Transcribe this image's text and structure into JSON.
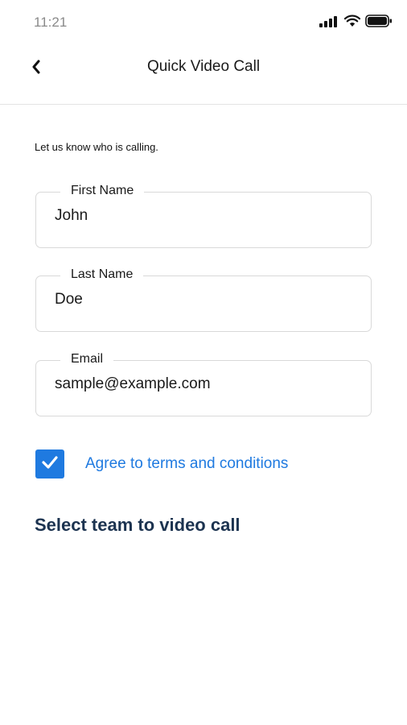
{
  "status_bar": {
    "time": "11:21",
    "signal_icon": "signal-bars-icon",
    "wifi_icon": "wifi-icon",
    "battery_icon": "battery-icon"
  },
  "header": {
    "back_icon": "chevron-left-icon",
    "title": "Quick Video Call"
  },
  "form": {
    "intro": "Let us know who is calling.",
    "first_name": {
      "label": "First Name",
      "value": "John"
    },
    "last_name": {
      "label": "Last Name",
      "value": "Doe"
    },
    "email": {
      "label": "Email",
      "value": "sample@example.com"
    },
    "terms": {
      "checked": true,
      "label": "Agree to terms and conditions"
    }
  },
  "team_section": {
    "title": "Select team to video call"
  },
  "colors": {
    "accent": "#1f7ae0",
    "section_title": "#1c3350",
    "field_border": "#d9d9d9"
  }
}
